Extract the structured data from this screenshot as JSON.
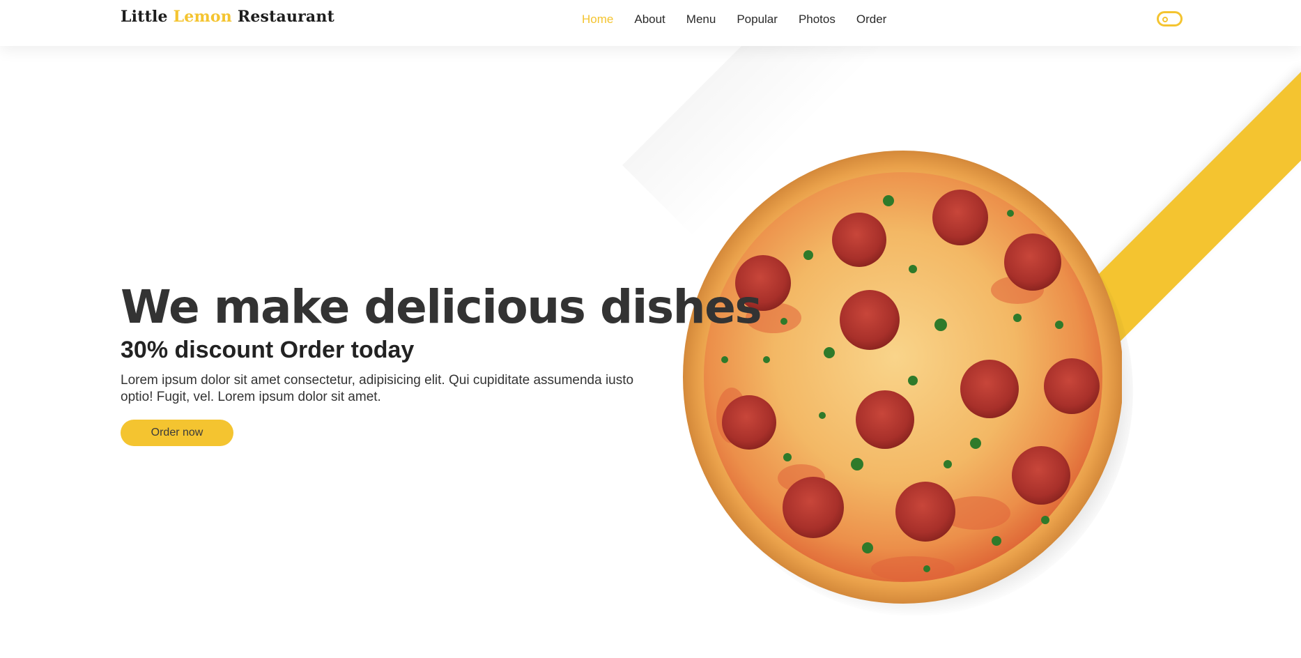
{
  "header": {
    "logo_part1": "Little ",
    "logo_accent": "Lemon",
    "logo_part2": " Restaurant",
    "nav": [
      {
        "label": "Home",
        "active": true
      },
      {
        "label": "About",
        "active": false
      },
      {
        "label": "Menu",
        "active": false
      },
      {
        "label": "Popular",
        "active": false
      },
      {
        "label": "Photos",
        "active": false
      },
      {
        "label": "Order",
        "active": false
      }
    ],
    "theme_toggle_icon": "toggle-switch-icon"
  },
  "hero": {
    "title": "We make delicious dishes",
    "subtitle": "30% discount Order today",
    "text": "Lorem ipsum dolor sit amet consectetur, adipisicing elit. Qui cupiditate assumenda iusto optio! Fugit, vel. Lorem ipsum dolor sit amet.",
    "button_label": "Order now",
    "image_icon": "pepperoni-pizza-image"
  },
  "colors": {
    "accent": "#f4c430",
    "text_dark": "#333333",
    "background": "#ffffff"
  }
}
